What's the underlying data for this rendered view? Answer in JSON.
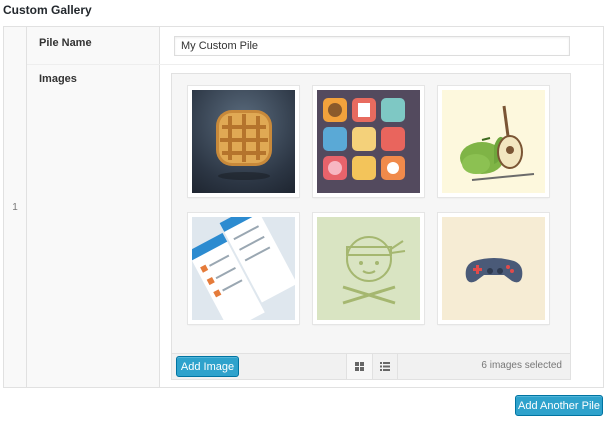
{
  "section_title": "Custom Gallery",
  "row_number": "1",
  "fields": {
    "pile_name_label": "Pile Name",
    "pile_name_value": "My Custom Pile",
    "images_label": "Images"
  },
  "gallery": {
    "images": [
      {
        "name": "waffle-icon-thumbnail"
      },
      {
        "name": "food-app-icons-thumbnail"
      },
      {
        "name": "pear-guitar-thumbnail"
      },
      {
        "name": "mobile-app-screens-thumbnail"
      },
      {
        "name": "ninja-face-thumbnail"
      },
      {
        "name": "game-controller-thumbnail"
      }
    ],
    "add_image_label": "Add Image",
    "grid_view_icon": "grid-icon",
    "list_view_icon": "list-icon",
    "selection_count": "6 images selected"
  },
  "add_pile_label": "Add Another Pile",
  "colors": {
    "accent": "#2ea2cc",
    "accent_border": "#0074a2",
    "panel_bg": "#f9f9f9",
    "border": "#e1e1e1"
  }
}
